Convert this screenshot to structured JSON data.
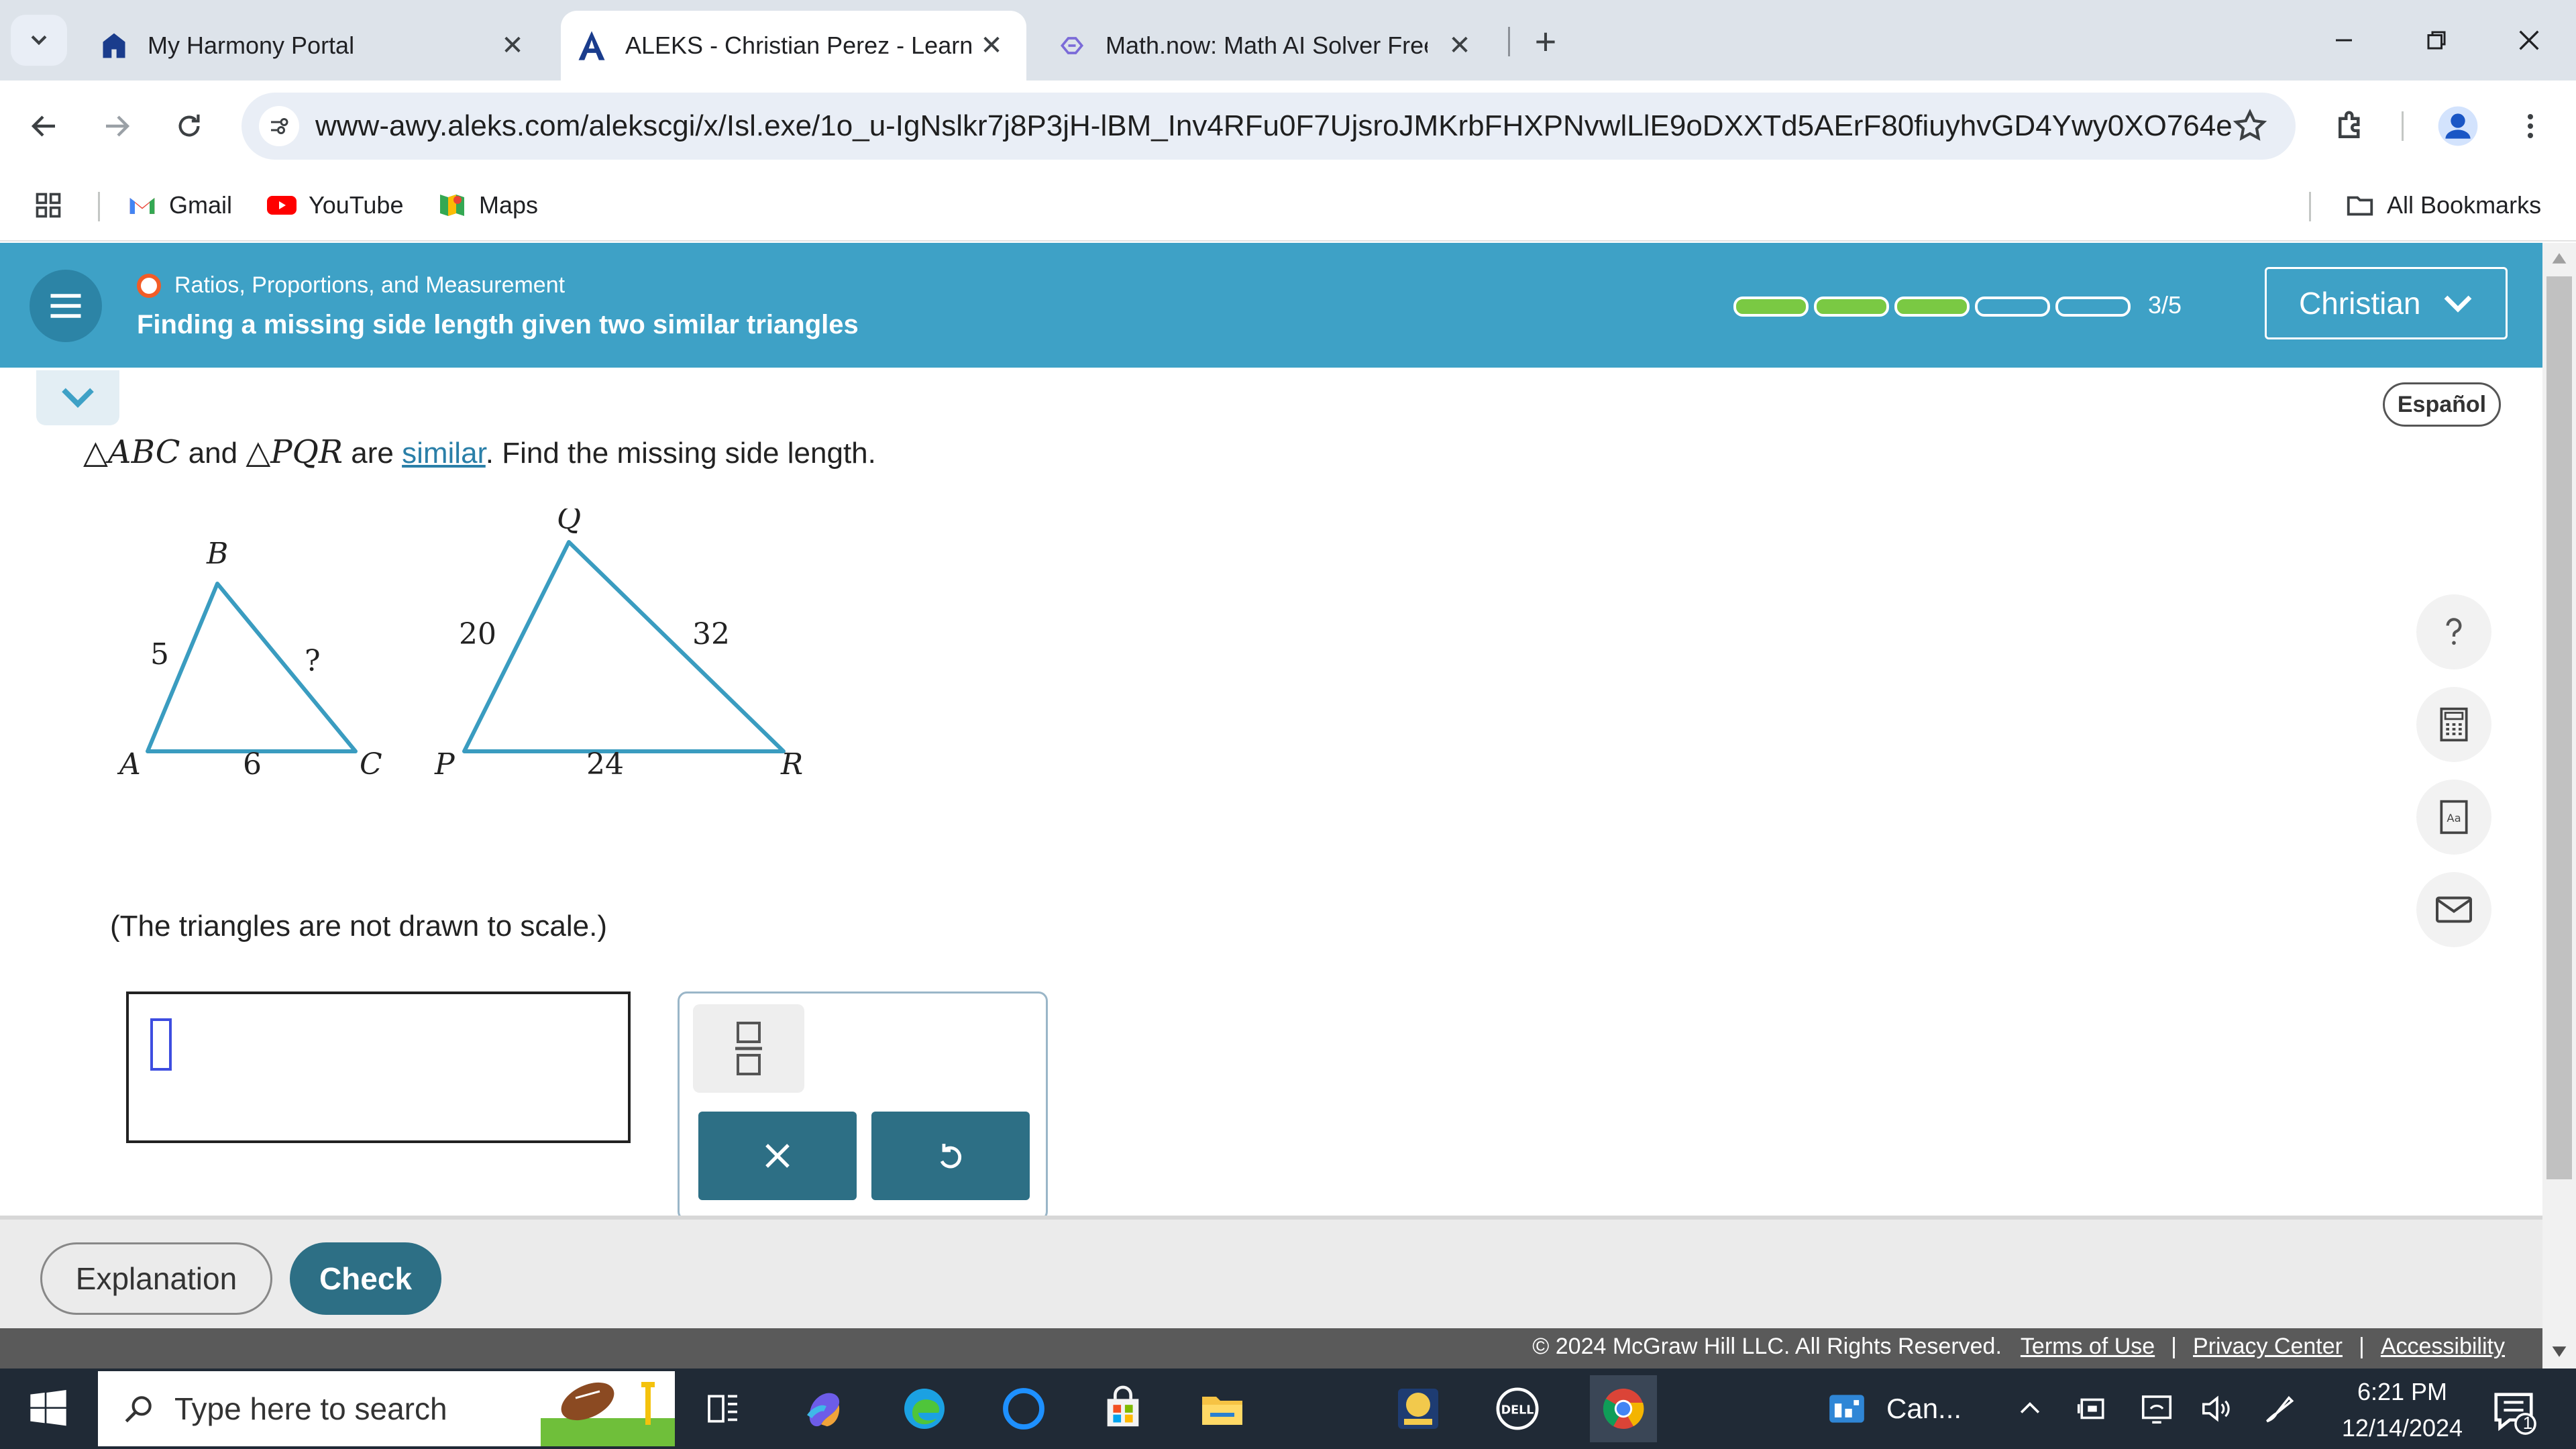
{
  "browser": {
    "tabs": [
      {
        "title": "My Harmony Portal",
        "active": false
      },
      {
        "title": "ALEKS - Christian Perez - Learn",
        "active": true
      },
      {
        "title": "Math.now: Math AI Solver Free",
        "active": false
      }
    ],
    "new_tab": "+",
    "url": "www-awy.aleks.com/alekscgi/x/Isl.exe/1o_u-IgNslkr7j8P3jH-lBM_Inv4RFu0F7UjsroJMKrbFHXPNvwlLlE9oDXXTd5AErF80fiuyhvGD4Ywy0XO764eEtUH31B...",
    "bookmarks": [
      "Gmail",
      "YouTube",
      "Maps"
    ],
    "all_bookmarks": "All Bookmarks"
  },
  "header": {
    "topic": "Ratios, Proportions, and Measurement",
    "lesson": "Finding a missing side length given two similar triangles",
    "progress": {
      "completed": 3,
      "total": 5,
      "label": "3/5"
    },
    "user": "Christian"
  },
  "problem": {
    "language_button": "Español",
    "q_tri1": "△ABC",
    "q_and": " and ",
    "q_tri2": "△PQR",
    "q_are": " are ",
    "q_link": "similar",
    "q_rest": ". Find the missing side length.",
    "note": "(The triangles are not drawn to scale.)"
  },
  "triangles": {
    "abc": {
      "vertices": [
        "A",
        "B",
        "C"
      ],
      "side_AB": "5",
      "side_BC": "?",
      "side_AC": "6"
    },
    "pqr": {
      "vertices": [
        "P",
        "Q",
        "R"
      ],
      "side_PQ": "20",
      "side_QR": "32",
      "side_PR": "24"
    }
  },
  "footer": {
    "explanation": "Explanation",
    "check": "Check",
    "copyright": "© 2024 McGraw Hill LLC. All Rights Reserved.",
    "links": [
      "Terms of Use",
      "Privacy Center",
      "Accessibility"
    ]
  },
  "taskbar": {
    "search_placeholder": "Type here to search",
    "pinned_label": "Can...",
    "time": "6:21 PM",
    "date": "12/14/2024",
    "notification_count": "1"
  },
  "colors": {
    "aleks_header": "#3ea1c6",
    "triangle_stroke": "#3a9cc0",
    "progress_done": "#7ac943",
    "action_button": "#2d6f85",
    "topic_dot": "#f25c27"
  }
}
